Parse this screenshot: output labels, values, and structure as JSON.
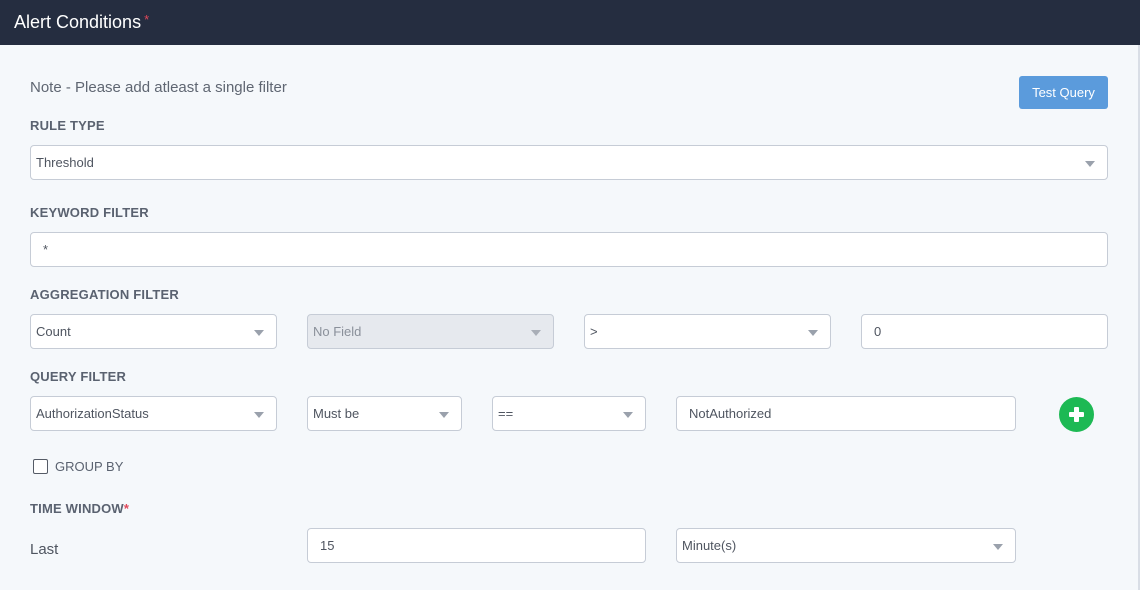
{
  "header": {
    "title": "Alert Conditions",
    "required_mark": "*"
  },
  "note": "Note - Please add atleast a single filter",
  "test_query_label": "Test Query",
  "rule_type": {
    "label": "RULE TYPE",
    "selected": "Threshold"
  },
  "keyword_filter": {
    "label": "KEYWORD FILTER",
    "value": "*"
  },
  "aggregation_filter": {
    "label": "AGGREGATION FILTER",
    "function": "Count",
    "field": "No Field",
    "operator": ">",
    "value": "0"
  },
  "query_filter": {
    "label": "QUERY FILTER",
    "field": "AuthorizationStatus",
    "condition": "Must be",
    "operator": "==",
    "value": "NotAuthorized"
  },
  "group_by": {
    "label": "GROUP BY",
    "checked": false
  },
  "time_window": {
    "label": "TIME WINDOW",
    "required_mark": "*",
    "prefix": "Last",
    "value": "15",
    "unit": "Minute(s)"
  },
  "colors": {
    "header_bg": "#252d40",
    "panel_bg": "#f5f8fb",
    "button_blue": "#5b9bdc",
    "add_green": "#1db954",
    "required_red": "#e0485a"
  },
  "icons": {
    "dropdown": "chevron-down-icon",
    "add": "plus-circle-icon"
  }
}
